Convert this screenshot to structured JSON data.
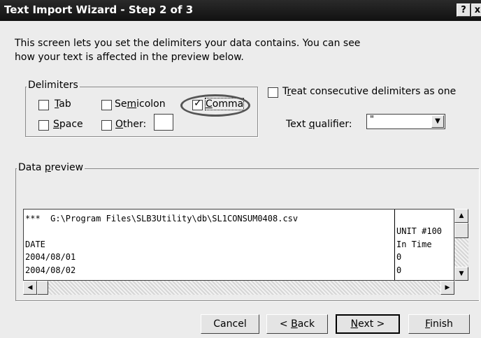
{
  "window": {
    "title": "Text Import Wizard - Step 2 of 3",
    "help_label": "?",
    "close_label": "x"
  },
  "intro": {
    "line1": "This screen lets you set the delimiters your data contains.  You can see",
    "line2": "how your text is affected in the preview below."
  },
  "delimiters": {
    "legend": "Delimiters",
    "tab": {
      "prefix": "",
      "accel": "T",
      "rest": "ab",
      "checked": false
    },
    "semicolon": {
      "prefix": "Se",
      "accel": "m",
      "rest": "icolon",
      "checked": false
    },
    "comma": {
      "prefix": "",
      "accel": "C",
      "rest": "omma",
      "checked": true
    },
    "space": {
      "prefix": "",
      "accel": "S",
      "rest": "pace",
      "checked": false
    },
    "other": {
      "prefix": "",
      "accel": "O",
      "rest": "ther:",
      "checked": false,
      "value": ""
    }
  },
  "options": {
    "consecutive": {
      "prefix": "T",
      "accel": "r",
      "rest": "eat consecutive delimiters as one",
      "checked": false
    },
    "qualifier": {
      "prefix": "Text ",
      "accel": "q",
      "rest": "ualifier:",
      "value": "\""
    }
  },
  "preview": {
    "legend_prefix": "Data ",
    "legend_accel": "p",
    "legend_rest": "review",
    "col1": [
      "***  G:\\Program Files\\SLB3Utility\\db\\SL1CONSUM0408.csv",
      "",
      "DATE",
      "2004/08/01",
      "2004/08/02"
    ],
    "col2": [
      "",
      "UNIT #100",
      "In Time",
      "0",
      "0"
    ]
  },
  "buttons": {
    "cancel": "Cancel",
    "back": {
      "prefix": "< ",
      "accel": "B",
      "rest": "ack"
    },
    "next": {
      "prefix": "",
      "accel": "N",
      "rest": "ext >"
    },
    "finish": {
      "prefix": "",
      "accel": "F",
      "rest": "inish"
    }
  }
}
